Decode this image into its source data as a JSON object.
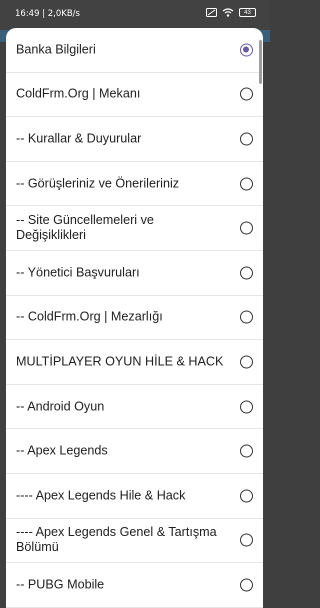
{
  "status_bar": {
    "time": "16:49 | 2,0KB/s",
    "battery": "43"
  },
  "dialog": {
    "options": [
      {
        "label": "Banka Bilgileri",
        "selected": true
      },
      {
        "label": "ColdFrm.Org | Mekanı",
        "selected": false
      },
      {
        "label": "-- Kurallar & Duyurular",
        "selected": false
      },
      {
        "label": "-- Görüşleriniz ve Önerileriniz",
        "selected": false
      },
      {
        "label": "-- Site Güncellemeleri ve Değişiklikleri",
        "selected": false
      },
      {
        "label": "-- Yönetici Başvuruları",
        "selected": false
      },
      {
        "label": "-- ColdFrm.Org | Mezarlığı",
        "selected": false
      },
      {
        "label": "MULTİPLAYER OYUN HİLE & HACK",
        "selected": false
      },
      {
        "label": "-- Android Oyun",
        "selected": false
      },
      {
        "label": "-- Apex Legends",
        "selected": false
      },
      {
        "label": "---- Apex Legends Hile & Hack",
        "selected": false
      },
      {
        "label": "---- Apex Legends Genel & Tartışma Bölümü",
        "selected": false
      },
      {
        "label": "-- PUBG Mobile",
        "selected": false
      }
    ]
  },
  "colors": {
    "accent": "#6a5aa0",
    "status_bar": "#424242"
  }
}
